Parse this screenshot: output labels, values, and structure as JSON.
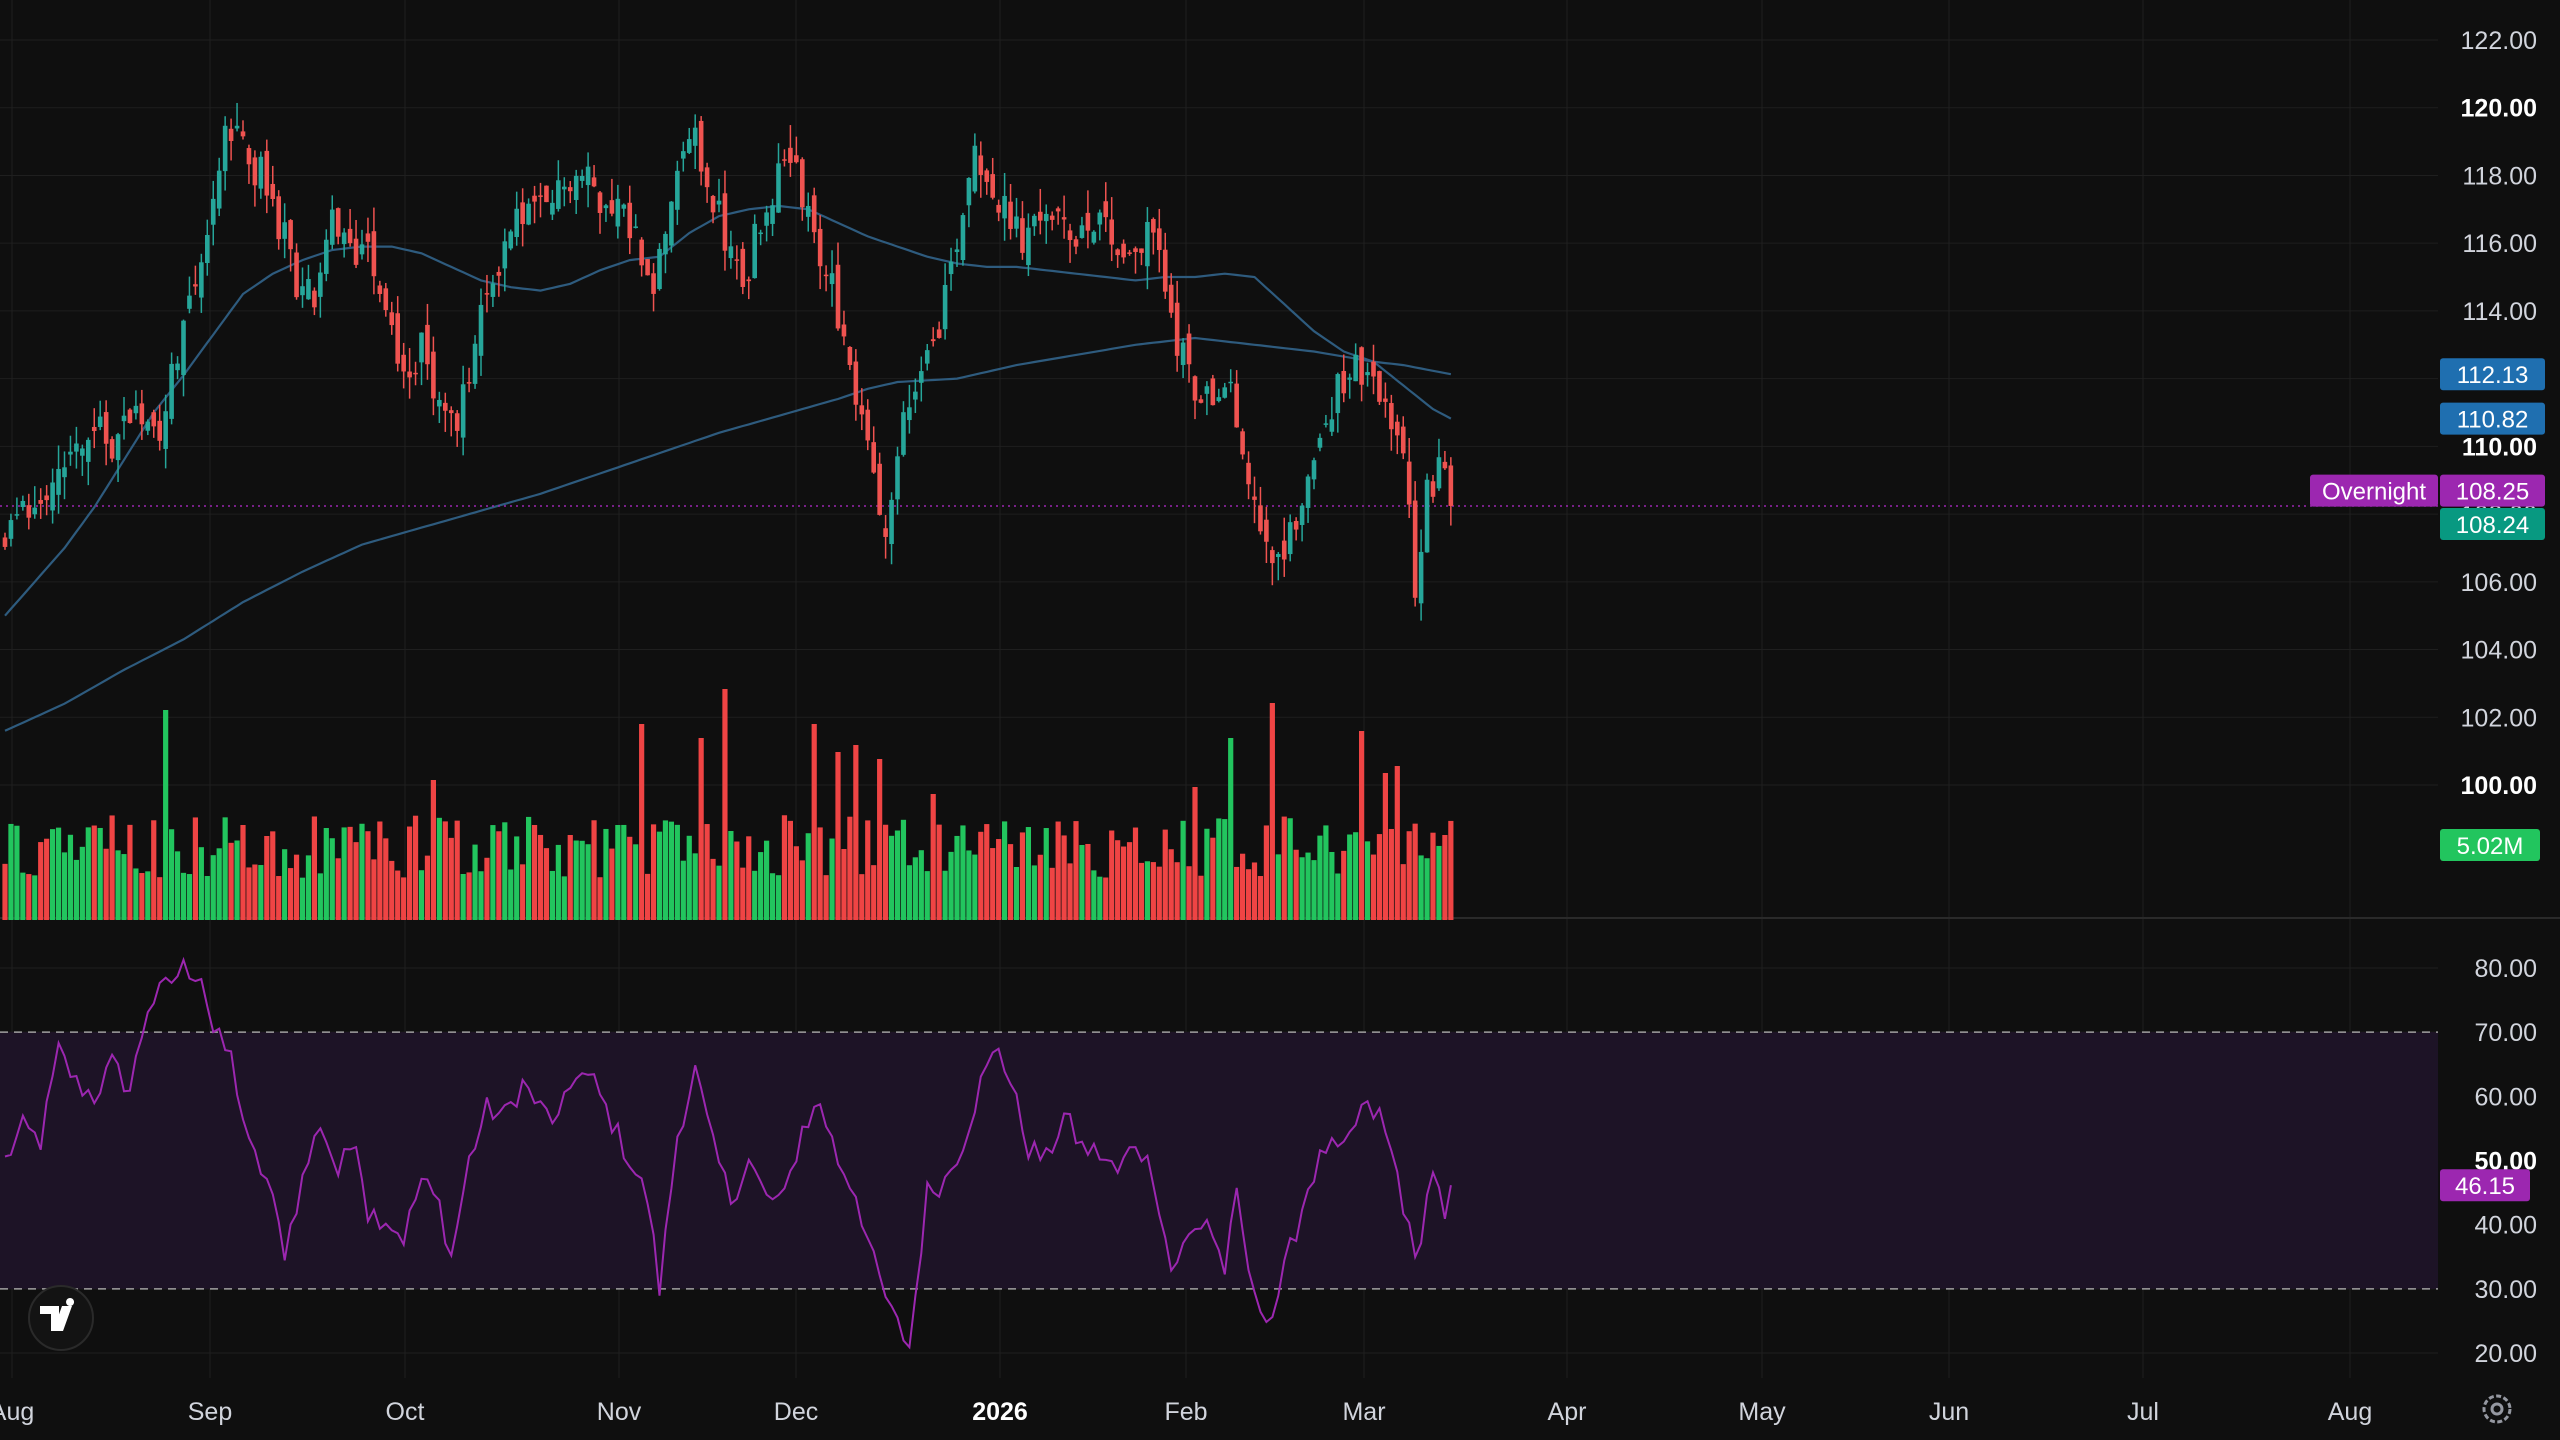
{
  "colors": {
    "background": "#0f0f0f",
    "grid": "#1f1f1f",
    "up": "#26a69a",
    "down": "#ef5350",
    "vol_up": "#22c55e",
    "vol_down": "#ef4444",
    "ma": "#2e5b7e",
    "rsi_line": "#9c27b0",
    "rsi_band": "#1d1326",
    "overnight": "#9c27b0",
    "ma_tag": "#1f6fb0",
    "last_tag": "#089981",
    "vol_tag": "#22c55e"
  },
  "chart_data": [
    {
      "type": "candlestick",
      "pane": "price",
      "ylim": [
        100,
        122
      ],
      "price_ticks": [
        "122.00",
        "120.00",
        "118.00",
        "116.00",
        "114.00",
        "112.00",
        "110.00",
        "108.00",
        "106.00",
        "104.00",
        "102.00",
        "100.00"
      ],
      "bold_ticks": [
        "120.00",
        "110.00",
        "100.00"
      ],
      "time_labels": [
        "Aug",
        "Sep",
        "Oct",
        "Nov",
        "Dec",
        "2026",
        "Feb",
        "Mar",
        "Apr",
        "May",
        "Jun",
        "Jul",
        "Aug"
      ],
      "bold_time_labels": [
        "2026"
      ],
      "close_path": [
        [
          0,
          107.0
        ],
        [
          3,
          108.0
        ],
        [
          6,
          108.6
        ],
        [
          10,
          109.7
        ],
        [
          14,
          110.4
        ],
        [
          18,
          110.2
        ],
        [
          22,
          111.3
        ],
        [
          26,
          110.7
        ],
        [
          30,
          113.8
        ],
        [
          34,
          116.3
        ],
        [
          37,
          119.1
        ],
        [
          40,
          118.9
        ],
        [
          43,
          118.0
        ],
        [
          46,
          116.6
        ],
        [
          49,
          115.0
        ],
        [
          52,
          114.3
        ],
        [
          55,
          116.5
        ],
        [
          58,
          115.6
        ],
        [
          61,
          116.3
        ],
        [
          64,
          114.2
        ],
        [
          67,
          112.0
        ],
        [
          70,
          112.8
        ],
        [
          73,
          111.1
        ],
        [
          76,
          110.5
        ],
        [
          79,
          113.0
        ],
        [
          82,
          115.0
        ],
        [
          85,
          116.5
        ],
        [
          88,
          117.0
        ],
        [
          91,
          116.9
        ],
        [
          94,
          117.8
        ],
        [
          97,
          118.0
        ],
        [
          100,
          117.4
        ],
        [
          103,
          117.2
        ],
        [
          106,
          116.2
        ],
        [
          109,
          115.0
        ],
        [
          112,
          117.5
        ],
        [
          115,
          119.5
        ],
        [
          118,
          117.8
        ],
        [
          121,
          116.2
        ],
        [
          124,
          114.8
        ],
        [
          127,
          116.7
        ],
        [
          130,
          117.9
        ],
        [
          133,
          118.1
        ],
        [
          136,
          115.8
        ],
        [
          139,
          114.8
        ],
        [
          142,
          112.4
        ],
        [
          145,
          110.0
        ],
        [
          148,
          107.2
        ],
        [
          151,
          110.9
        ],
        [
          154,
          112.2
        ],
        [
          157,
          113.8
        ],
        [
          160,
          116.2
        ],
        [
          163,
          119.0
        ],
        [
          166,
          117.6
        ],
        [
          169,
          116.5
        ],
        [
          172,
          116.0
        ],
        [
          175,
          117.1
        ],
        [
          178,
          116.2
        ],
        [
          181,
          116.5
        ],
        [
          184,
          117.0
        ],
        [
          187,
          115.9
        ],
        [
          190,
          115.7
        ],
        [
          193,
          116.4
        ],
        [
          196,
          113.8
        ],
        [
          199,
          112.1
        ],
        [
          202,
          111.5
        ],
        [
          205,
          112.3
        ],
        [
          208,
          109.8
        ],
        [
          211,
          107.1
        ],
        [
          214,
          106.4
        ],
        [
          217,
          108.0
        ],
        [
          220,
          109.5
        ],
        [
          223,
          111.3
        ],
        [
          226,
          112.4
        ],
        [
          229,
          112.0
        ],
        [
          232,
          111.0
        ],
        [
          235,
          109.5
        ],
        [
          237,
          106.1
        ],
        [
          239,
          108.7
        ],
        [
          241,
          109.3
        ],
        [
          243,
          108.24
        ]
      ],
      "ma_short_path": [
        [
          0,
          105.0
        ],
        [
          5,
          106.0
        ],
        [
          10,
          107.0
        ],
        [
          15,
          108.2
        ],
        [
          20,
          109.6
        ],
        [
          25,
          111.0
        ],
        [
          30,
          112.1
        ],
        [
          35,
          113.3
        ],
        [
          40,
          114.5
        ],
        [
          45,
          115.1
        ],
        [
          50,
          115.5
        ],
        [
          55,
          115.8
        ],
        [
          60,
          115.9
        ],
        [
          65,
          115.9
        ],
        [
          70,
          115.7
        ],
        [
          75,
          115.3
        ],
        [
          80,
          114.9
        ],
        [
          85,
          114.7
        ],
        [
          90,
          114.6
        ],
        [
          95,
          114.8
        ],
        [
          100,
          115.2
        ],
        [
          105,
          115.5
        ],
        [
          110,
          115.6
        ],
        [
          115,
          116.3
        ],
        [
          120,
          116.8
        ],
        [
          125,
          117.0
        ],
        [
          130,
          117.1
        ],
        [
          135,
          117.0
        ],
        [
          140,
          116.6
        ],
        [
          145,
          116.2
        ],
        [
          150,
          115.9
        ],
        [
          155,
          115.6
        ],
        [
          160,
          115.4
        ],
        [
          165,
          115.3
        ],
        [
          170,
          115.3
        ],
        [
          175,
          115.2
        ],
        [
          180,
          115.1
        ],
        [
          185,
          115.0
        ],
        [
          190,
          114.9
        ],
        [
          195,
          115.0
        ],
        [
          200,
          115.0
        ],
        [
          205,
          115.1
        ],
        [
          210,
          115.0
        ],
        [
          215,
          114.2
        ],
        [
          220,
          113.4
        ],
        [
          225,
          112.8
        ],
        [
          230,
          112.5
        ],
        [
          235,
          111.8
        ],
        [
          240,
          111.1
        ],
        [
          243,
          110.82
        ]
      ],
      "ma_long_path": [
        [
          0,
          101.6
        ],
        [
          10,
          102.4
        ],
        [
          20,
          103.4
        ],
        [
          30,
          104.3
        ],
        [
          40,
          105.4
        ],
        [
          50,
          106.3
        ],
        [
          60,
          107.1
        ],
        [
          70,
          107.6
        ],
        [
          80,
          108.1
        ],
        [
          90,
          108.6
        ],
        [
          100,
          109.2
        ],
        [
          110,
          109.8
        ],
        [
          120,
          110.4
        ],
        [
          130,
          110.9
        ],
        [
          140,
          111.4
        ],
        [
          145,
          111.7
        ],
        [
          150,
          111.9
        ],
        [
          160,
          112.0
        ],
        [
          170,
          112.4
        ],
        [
          180,
          112.7
        ],
        [
          190,
          113.0
        ],
        [
          200,
          113.2
        ],
        [
          210,
          113.0
        ],
        [
          220,
          112.8
        ],
        [
          230,
          112.5
        ],
        [
          235,
          112.4
        ],
        [
          243,
          112.13
        ]
      ],
      "overnight_label": "Overnight",
      "overnight_value": "108.25",
      "ma_long_value": "112.13",
      "ma_short_value": "110.82",
      "last_value": "108.24"
    },
    {
      "type": "bar",
      "pane": "volume",
      "last_volume_label": "5.02M",
      "spike_volumes": [
        [
          27,
          3.0
        ],
        [
          72,
          2.0
        ],
        [
          107,
          2.8
        ],
        [
          117,
          2.6
        ],
        [
          121,
          3.3
        ],
        [
          136,
          2.8
        ],
        [
          140,
          2.4
        ],
        [
          143,
          2.5
        ],
        [
          147,
          2.3
        ],
        [
          156,
          1.8
        ],
        [
          200,
          1.9
        ],
        [
          206,
          2.6
        ],
        [
          213,
          3.1
        ],
        [
          228,
          2.7
        ],
        [
          232,
          2.1
        ],
        [
          234,
          2.2
        ]
      ]
    },
    {
      "type": "line",
      "pane": "rsi",
      "ylim": [
        15,
        85
      ],
      "rsi_ticks": [
        "80.00",
        "70.00",
        "60.00",
        "50.00",
        "40.00",
        "30.00",
        "20.00"
      ],
      "bold_ticks": [
        "50.00"
      ],
      "band": [
        30,
        70
      ],
      "rsi_path": [
        [
          0,
          50
        ],
        [
          3,
          55
        ],
        [
          6,
          53
        ],
        [
          9,
          67
        ],
        [
          12,
          62
        ],
        [
          15,
          60
        ],
        [
          18,
          65
        ],
        [
          21,
          61
        ],
        [
          24,
          74
        ],
        [
          27,
          77
        ],
        [
          30,
          80
        ],
        [
          33,
          79
        ],
        [
          35,
          70
        ],
        [
          38,
          66
        ],
        [
          41,
          52
        ],
        [
          44,
          47
        ],
        [
          47,
          36
        ],
        [
          50,
          47
        ],
        [
          53,
          56
        ],
        [
          56,
          48
        ],
        [
          59,
          54
        ],
        [
          61,
          42
        ],
        [
          64,
          41
        ],
        [
          67,
          38
        ],
        [
          70,
          47
        ],
        [
          73,
          43
        ],
        [
          75,
          35
        ],
        [
          78,
          50
        ],
        [
          81,
          58
        ],
        [
          84,
          57
        ],
        [
          87,
          62
        ],
        [
          90,
          58
        ],
        [
          93,
          56
        ],
        [
          96,
          64
        ],
        [
          99,
          62
        ],
        [
          102,
          56
        ],
        [
          105,
          50
        ],
        [
          108,
          44
        ],
        [
          110,
          30
        ],
        [
          113,
          54
        ],
        [
          116,
          64
        ],
        [
          119,
          52
        ],
        [
          122,
          44
        ],
        [
          125,
          50
        ],
        [
          128,
          44
        ],
        [
          131,
          44
        ],
        [
          134,
          55
        ],
        [
          137,
          59
        ],
        [
          140,
          50
        ],
        [
          143,
          45
        ],
        [
          146,
          34
        ],
        [
          149,
          26
        ],
        [
          152,
          21
        ],
        [
          155,
          45
        ],
        [
          158,
          47
        ],
        [
          161,
          53
        ],
        [
          164,
          62
        ],
        [
          167,
          68
        ],
        [
          169,
          62
        ],
        [
          172,
          52
        ],
        [
          175,
          50
        ],
        [
          178,
          57
        ],
        [
          181,
          52
        ],
        [
          184,
          51
        ],
        [
          187,
          48
        ],
        [
          190,
          53
        ],
        [
          193,
          48
        ],
        [
          196,
          33
        ],
        [
          199,
          38
        ],
        [
          202,
          41
        ],
        [
          205,
          33
        ],
        [
          207,
          44
        ],
        [
          210,
          28
        ],
        [
          213,
          26
        ],
        [
          216,
          36
        ],
        [
          219,
          46
        ],
        [
          222,
          52
        ],
        [
          225,
          51
        ],
        [
          228,
          58
        ],
        [
          231,
          57
        ],
        [
          234,
          48
        ],
        [
          237,
          34
        ],
        [
          240,
          49
        ],
        [
          242,
          40
        ],
        [
          243,
          46.15
        ]
      ],
      "last_value": "46.15"
    }
  ]
}
